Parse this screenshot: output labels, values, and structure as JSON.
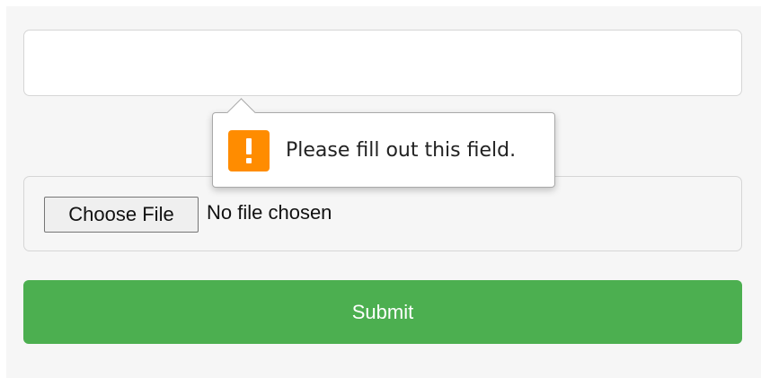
{
  "form": {
    "text_field": {
      "value": "",
      "placeholder": ""
    },
    "file_input": {
      "button_label": "Choose File",
      "status": "No file chosen"
    },
    "submit_label": "Submit"
  },
  "validation_tooltip": {
    "icon": "warning-icon",
    "message": "Please fill out this field."
  },
  "colors": {
    "submit_background": "#4caf50",
    "warning_icon": "#ff8c00",
    "panel_background": "#f6f6f6"
  }
}
